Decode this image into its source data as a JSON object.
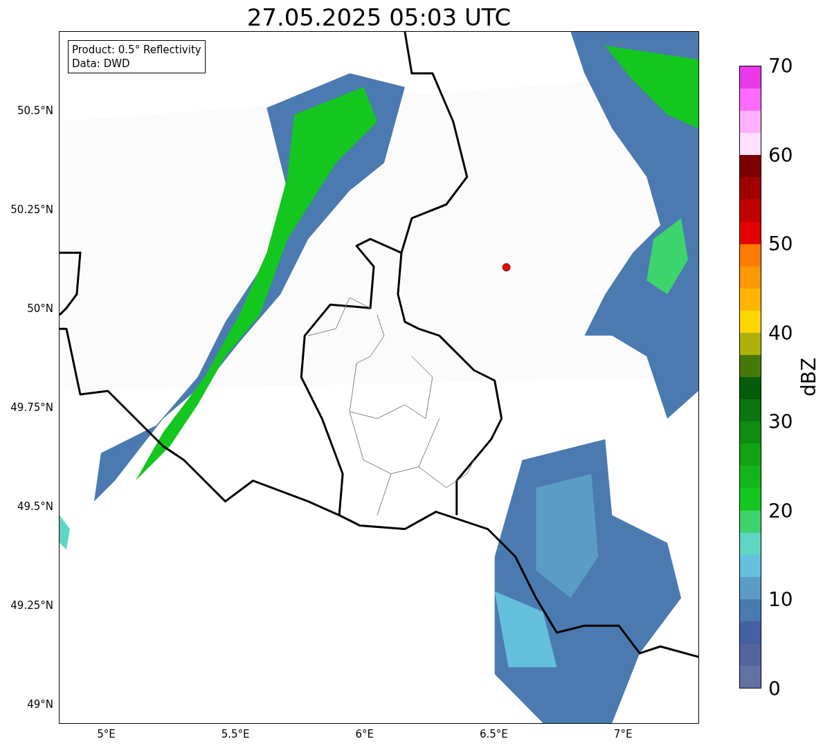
{
  "title": "27.05.2025 05:03 UTC",
  "legend": [
    "Product: 0.5° Reflectivity",
    "Data: DWD"
  ],
  "y_ticks": [
    "50.5°N",
    "50.25°N",
    "50°N",
    "49.75°N",
    "49.5°N",
    "49.25°N",
    "49°N"
  ],
  "x_ticks": [
    "5°E",
    "5.5°E",
    "6°E",
    "6.5°E",
    "7°E"
  ],
  "colorbar": {
    "label": "dBZ",
    "ticks": [
      "70",
      "60",
      "50",
      "40",
      "30",
      "20",
      "10",
      "0"
    ],
    "bins": [
      {
        "color": "#6272a4"
      },
      {
        "color": "#52649e"
      },
      {
        "color": "#4260a2"
      },
      {
        "color": "#4a7ab0"
      },
      {
        "color": "#5a9cc6"
      },
      {
        "color": "#64c0dc"
      },
      {
        "color": "#5fd6c4"
      },
      {
        "color": "#3dd46e"
      },
      {
        "color": "#14c71e"
      },
      {
        "color": "#12b61a"
      },
      {
        "color": "#11a314"
      },
      {
        "color": "#0d8c10"
      },
      {
        "color": "#0b7510"
      },
      {
        "color": "#065c0a"
      },
      {
        "color": "#457a0a"
      },
      {
        "color": "#adb10a"
      },
      {
        "color": "#ffd700"
      },
      {
        "color": "#ffb500"
      },
      {
        "color": "#ff9800"
      },
      {
        "color": "#ff7b00"
      },
      {
        "color": "#e30000"
      },
      {
        "color": "#c00000"
      },
      {
        "color": "#a00000"
      },
      {
        "color": "#7c0000"
      },
      {
        "color": "#ffe0ff"
      },
      {
        "color": "#ffb0ff"
      },
      {
        "color": "#ff6aff"
      },
      {
        "color": "#ea38ea"
      }
    ]
  }
}
